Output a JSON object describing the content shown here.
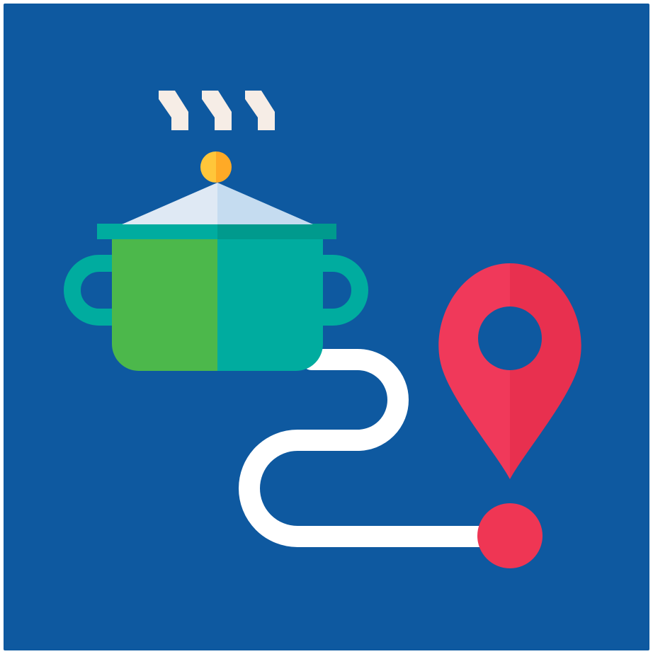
{
  "colors": {
    "background": "#0e59a0",
    "border": "#ffffff",
    "pot_left": "#4cb84b",
    "pot_right": "#00ac9f",
    "pot_rim_left": "#00ac9f",
    "pot_rim_right": "#009a8d",
    "pot_handle": "#00ac9f",
    "lid_left": "#dfe9f4",
    "lid_right": "#c5dcf0",
    "lid_knob_left": "#ffc63a",
    "lid_knob_right": "#ffaa26",
    "steam": "#f6ede6",
    "path": "#ffffff",
    "pin_left": "#f0395a",
    "pin_right": "#e8304f",
    "destination_dot": "#ef3654"
  },
  "icons": {
    "pot": "cooking-pot-icon",
    "steam": "steam-icon",
    "route": "route-path-icon",
    "pin": "location-pin-icon",
    "destination": "destination-dot-icon"
  }
}
